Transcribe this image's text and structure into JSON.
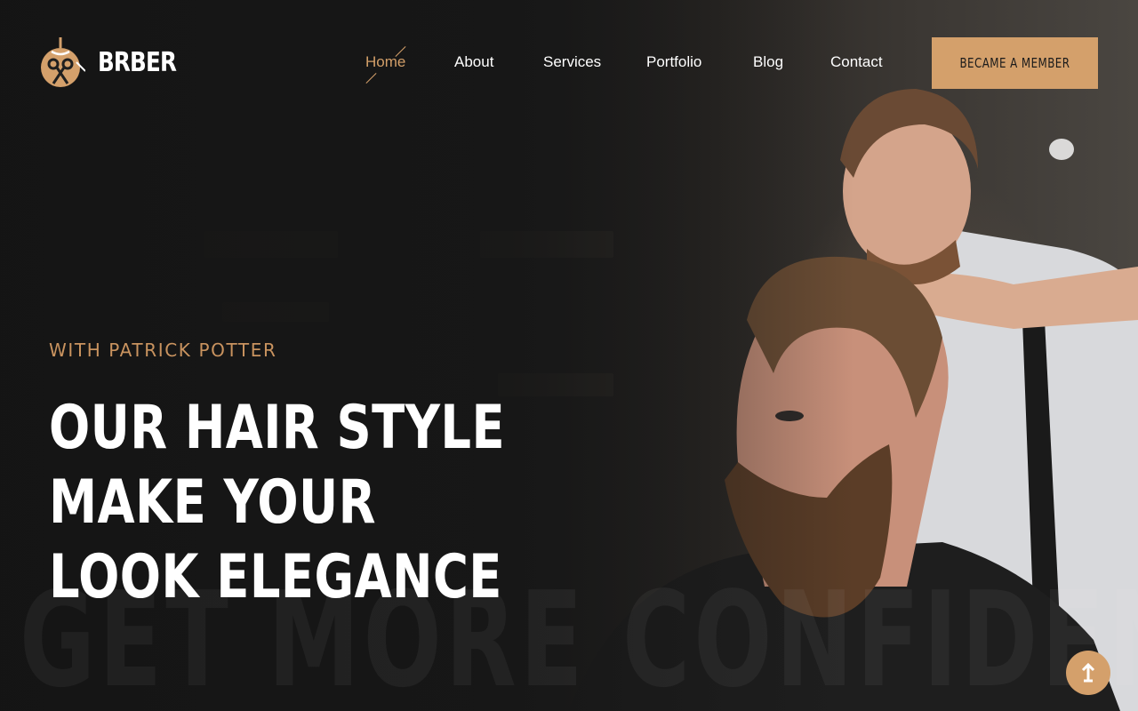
{
  "brand": {
    "name": "BRBER",
    "accent": "#d4a06b"
  },
  "nav": {
    "items": [
      {
        "label": "Home",
        "active": true
      },
      {
        "label": "About",
        "active": false
      },
      {
        "label": "Services",
        "active": false
      },
      {
        "label": "Portfolio",
        "active": false
      },
      {
        "label": "Blog",
        "active": false
      },
      {
        "label": "Contact",
        "active": false
      }
    ]
  },
  "cta": {
    "label": "BECAME A MEMBER"
  },
  "hero": {
    "eyebrow": "WITH PATRICK POTTER",
    "headline_line1": "OUR HAIR STYLE MAKE YOUR",
    "headline_line2": "LOOK ELEGANCE",
    "background_word": "GET MORE CONFIDENT",
    "photo_subject": "barber styling a bearded client"
  },
  "scroll_top": {
    "icon": "arrow-up-icon"
  }
}
